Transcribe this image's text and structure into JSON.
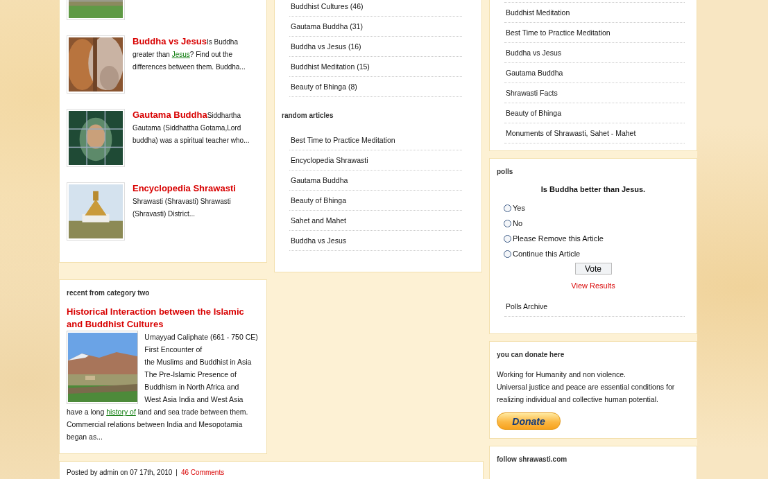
{
  "articles": [
    {
      "kind": "picture"
    },
    {
      "kind": "picture",
      "title": "Buddha vs Jesus",
      "text": "Is Buddha greater than ",
      "link": "Jesus",
      "after": "? Find out the differences between them. Buddha..."
    },
    {
      "kind": "picture",
      "title": "Gautama Buddha",
      "text": "Siddhartha Gautama (Siddhattha Gotama,Lord buddha) was a spiritual teacher who..."
    },
    {
      "kind": "picture",
      "title": "Encyclopedia Shrawasti",
      "text": "Shrawasti (Shravasti) Shrawasti (Shravasti) District..."
    }
  ],
  "category_two": {
    "heading": "recent from category two",
    "title": "Historical Interaction between the Islamic and Buddhist Cultures",
    "lines": [
      "Umayyad Caliphate (661 - 750 CE) First Encounter of",
      "the Muslims and Buddhist in Asia",
      "The Pre-Islamic Presence of",
      "Buddhism in North Africa and",
      "West Asia India and West Asia"
    ],
    "text": "have a long ",
    "link": "history of",
    "after": " land and sea trade between them. Commercial relations between India and Mesopotamia began as..."
  },
  "categories": [
    "Buddhist Cultures (46)",
    "Gautama Buddha (31)",
    "Buddha vs Jesus (16)",
    "Buddhist Meditation (15)",
    "Beauty of Bhinga (8)"
  ],
  "random_articles": {
    "heading": "random articles",
    "items": [
      "Best Time to Practice Meditation",
      "Encyclopedia Shrawasti",
      "Gautama Buddha",
      "Beauty of Bhinga",
      "Sahet and Mahet",
      "Buddha vs Jesus"
    ]
  },
  "popular": [
    "Buddhist Meditation",
    "Best Time to Practice Meditation",
    "Buddha vs Jesus",
    "Gautama Buddha",
    "Shrawasti Facts",
    "Beauty of Bhinga",
    "Monuments of Shrawasti, Sahet - Mahet"
  ],
  "polls": {
    "heading": "polls",
    "question": "Is Buddha better than Jesus.",
    "options": [
      {
        "label": "Yes",
        "selected": false
      },
      {
        "label": "No",
        "selected": false
      },
      {
        "label": "Please Remove this Article",
        "selected": false
      },
      {
        "label": "Continue this Article",
        "selected": false
      }
    ],
    "vote": "Vote",
    "results": "View Results",
    "archive": "Polls Archive"
  },
  "donate": {
    "heading": "you can donate here",
    "lines": [
      "Working for Humanity and non violence.",
      "Universal justice and peace are essential conditions for realizing individual and collective human potential."
    ],
    "button": "Donate"
  },
  "follow": {
    "heading": "follow shrawasti.com"
  },
  "post_meta": {
    "text": "Posted by admin on 07 17th, 2010",
    "separator": "|",
    "comments": "46 Comments"
  }
}
